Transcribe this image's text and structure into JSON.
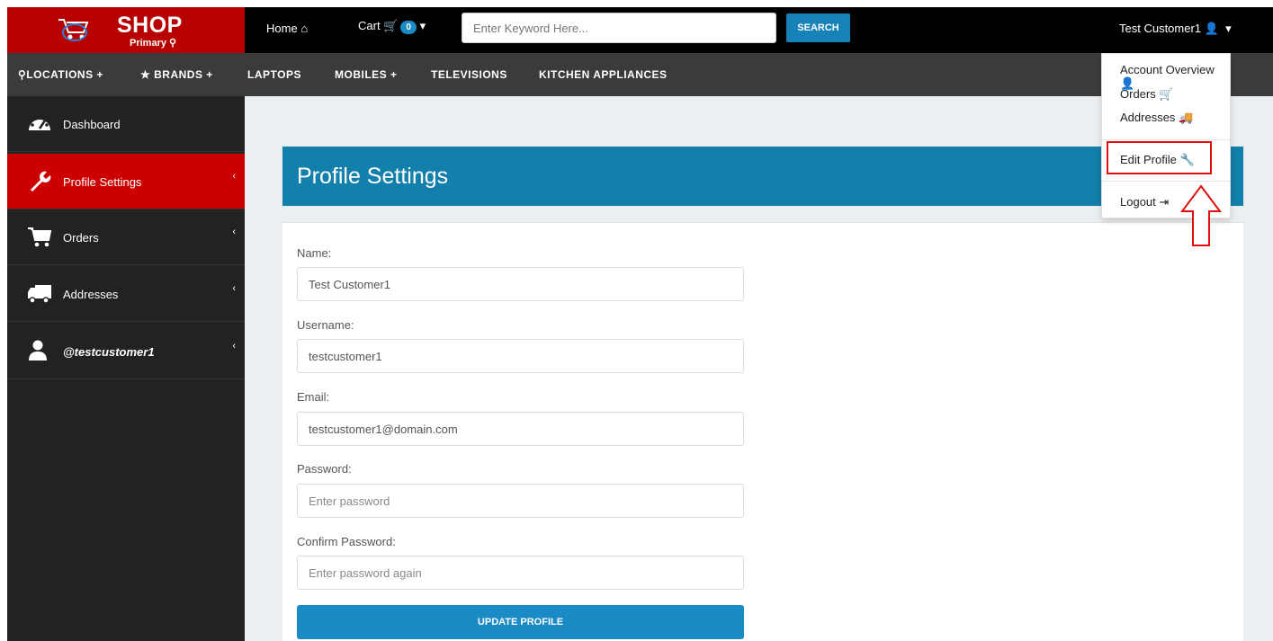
{
  "header": {
    "logo_title": "SHOP",
    "logo_subtitle": "Primary",
    "nav_home": "Home",
    "nav_cart": "Cart",
    "cart_count": "0",
    "search_placeholder": "Enter Keyword Here...",
    "search_button": "SEARCH",
    "user_name": "Test Customer1"
  },
  "categories": [
    "LOCATIONS",
    "BRANDS",
    "LAPTOPS",
    "MOBILES",
    "TELEVISIONS",
    "KITCHEN APPLIANCES"
  ],
  "sidebar": {
    "items": [
      {
        "label": "Dashboard"
      },
      {
        "label": "Profile Settings"
      },
      {
        "label": "Orders"
      },
      {
        "label": "Addresses"
      },
      {
        "label": "@testcustomer1"
      }
    ]
  },
  "main": {
    "title": "Profile Settings",
    "fields": [
      {
        "label": "Name:",
        "value": "Test Customer1",
        "placeholder": ""
      },
      {
        "label": "Username:",
        "value": "testcustomer1",
        "placeholder": ""
      },
      {
        "label": "Email:",
        "value": "testcustomer1@domain.com",
        "placeholder": ""
      },
      {
        "label": "Password:",
        "value": "",
        "placeholder": "Enter password"
      },
      {
        "label": "Confirm Password:",
        "value": "",
        "placeholder": "Enter password again"
      }
    ],
    "submit": "UPDATE PROFILE"
  },
  "dropdown": {
    "items": [
      {
        "label": "Account Overview"
      },
      {
        "label": "Orders"
      },
      {
        "label": "Addresses"
      },
      {
        "label": "Edit Profile"
      },
      {
        "label": "Logout"
      }
    ]
  },
  "colors": {
    "brand_red": "#cc0000",
    "accent_blue": "#137fab",
    "button_blue": "#1a8bc4",
    "highlight": "#e01010"
  }
}
